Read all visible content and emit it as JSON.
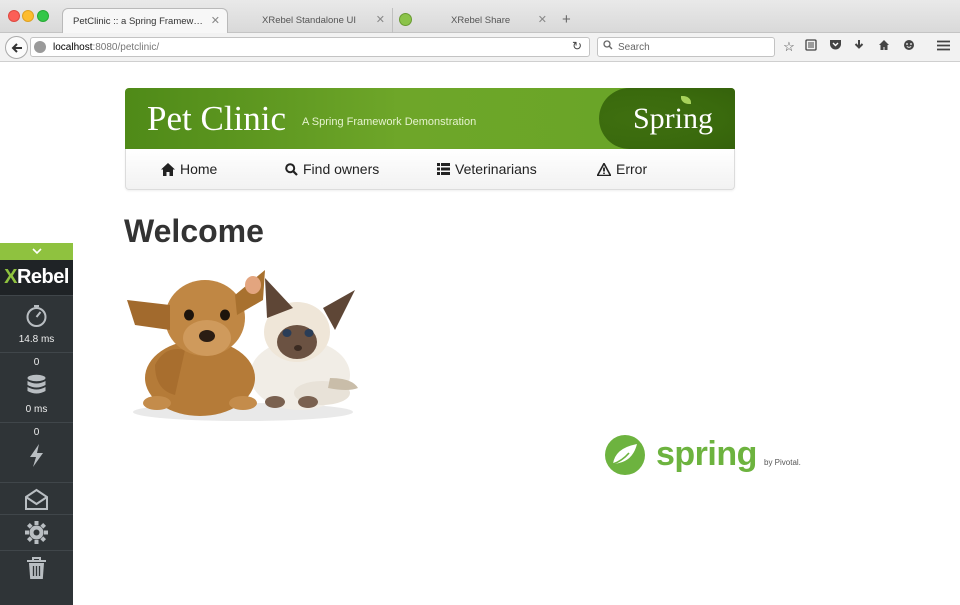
{
  "browser": {
    "tabs": [
      {
        "label": "PetClinic :: a Spring Framework de...",
        "active": true
      },
      {
        "label": "XRebel Standalone UI",
        "active": false
      },
      {
        "label": "XRebel Share",
        "active": false
      }
    ],
    "url_host": "localhost",
    "url_rest": ":8080/petclinic/",
    "search_placeholder": "Search"
  },
  "xrebel": {
    "logo_x": "X",
    "logo_rest": "Rebel",
    "timer_value": "14.8 ms",
    "db_count": "0",
    "db_time": "0 ms",
    "exceptions_count": "0"
  },
  "banner": {
    "title": "Pet Clinic",
    "subtitle": "A Spring Framework Demonstration",
    "brand": "Spring"
  },
  "menu": [
    {
      "label": "Home",
      "icon": "home-icon"
    },
    {
      "label": "Find owners",
      "icon": "search-icon"
    },
    {
      "label": "Veterinarians",
      "icon": "list-icon"
    },
    {
      "label": "Error",
      "icon": "warning-icon"
    }
  ],
  "page": {
    "heading": "Welcome"
  },
  "footer_logo": {
    "word": "spring",
    "by": "by Pivotal."
  },
  "colors": {
    "spring_green": "#6db33f",
    "banner_green": "#6ea629",
    "xrebel_green": "#8fc23f",
    "xrebel_panel": "#2f3437"
  }
}
